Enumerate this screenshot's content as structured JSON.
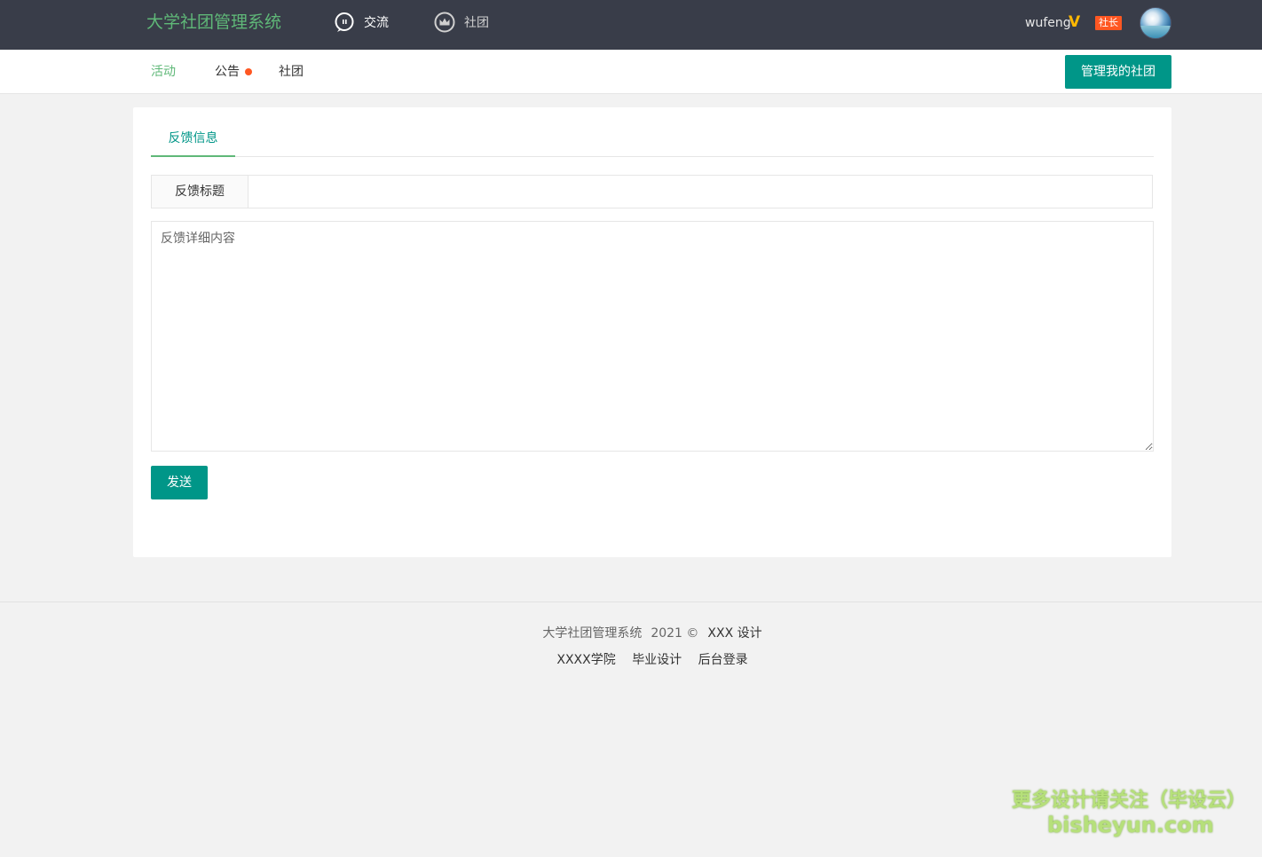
{
  "header": {
    "logo": "大学社团管理系统",
    "nav": [
      {
        "label": "交流",
        "icon": "chat-icon"
      },
      {
        "label": "社团",
        "icon": "crown-icon"
      }
    ],
    "user": {
      "name": "wufeng",
      "vip_icon": "V",
      "role": "社长"
    }
  },
  "subnav": {
    "items": [
      {
        "label": "活动",
        "active": true
      },
      {
        "label": "公告",
        "has_dot": true
      },
      {
        "label": "社团"
      }
    ],
    "manage_button": "管理我的社团"
  },
  "card": {
    "tab": "反馈信息",
    "title_label": "反馈标题",
    "title_value": "",
    "content_placeholder": "反馈详细内容",
    "send_button": "发送"
  },
  "footer": {
    "system_name": "大学社团管理系统",
    "year": "2021 ©",
    "design": "XXX 设计",
    "links": [
      "XXXX学院",
      "毕业设计",
      "后台登录"
    ]
  },
  "watermark": {
    "line1": "更多设计请关注（毕设云）",
    "line2": "bisheyun.com"
  },
  "colors": {
    "header_bg": "#393d49",
    "logo": "#5fb878",
    "accent": "#009688",
    "badge": "#ff5722"
  }
}
